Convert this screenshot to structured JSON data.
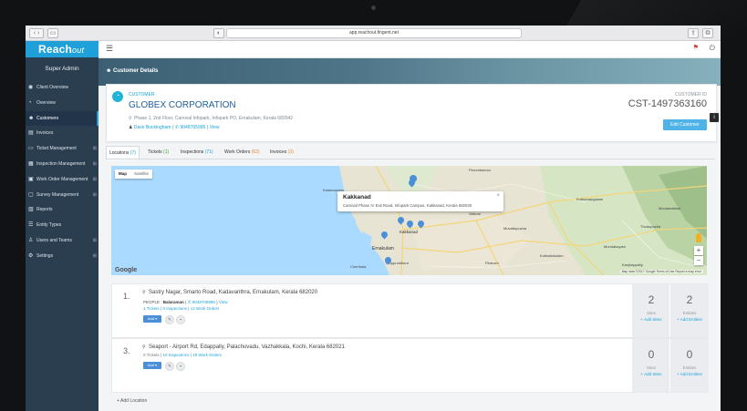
{
  "browser": {
    "url": "app.reachout.fingent.net"
  },
  "brand": {
    "name_a": "Reach",
    "name_b": "out"
  },
  "sidebar": {
    "role": "Super Admin",
    "items": [
      {
        "label": "Client Overview",
        "icon": "dashboard-icon",
        "caret": ""
      },
      {
        "label": "Overview",
        "icon": "pie-chart-icon",
        "caret": ""
      },
      {
        "label": "Customers",
        "icon": "users-icon",
        "caret": ""
      },
      {
        "label": "Invoices",
        "icon": "money-icon",
        "caret": ""
      },
      {
        "label": "Ticket Management",
        "icon": "monitor-icon",
        "caret": "⊞"
      },
      {
        "label": "Inspection Management",
        "icon": "clipboard-icon",
        "caret": "⊞"
      },
      {
        "label": "Work Order Management",
        "icon": "calendar-icon",
        "caret": "⊞"
      },
      {
        "label": "Survey Management",
        "icon": "comment-icon",
        "caret": "⊞"
      },
      {
        "label": "Reports",
        "icon": "bar-chart-icon",
        "caret": ""
      },
      {
        "label": "Entity Types",
        "icon": "list-icon",
        "caret": ""
      },
      {
        "label": "Users and Teams",
        "icon": "user-icon",
        "caret": "⊞"
      },
      {
        "label": "Settings",
        "icon": "gear-icon",
        "caret": "⊞"
      }
    ]
  },
  "header": {
    "title": "Customer Details"
  },
  "customer": {
    "label": "CUSTOMER",
    "name": "GLOBEX CORPORATION",
    "address": "Phase 1, 2nd Floor, Carnival Infopark, Infopark PO, Ernakulam, Kerala 682042",
    "contact_name": "Dave Buckingham",
    "contact_phone": "9048705995",
    "contact_view": "View",
    "id_label": "CUSTOMER ID",
    "id": "CST-1497363160",
    "edit_label": "Edit Customer"
  },
  "tabs": [
    {
      "label": "Locations",
      "count": "(7)"
    },
    {
      "label": "Tickets",
      "count": "(1)"
    },
    {
      "label": "Inspections",
      "count": "(71)"
    },
    {
      "label": "Work Orders",
      "count": "(62)"
    },
    {
      "label": "Invoices",
      "count": "(3)"
    }
  ],
  "map": {
    "toggle_map": "Map",
    "toggle_satellite": "Satellite",
    "info_title": "Kakkanad",
    "info_address": "Carnival Phase IV Exit Road, Infopark Campus, Kakkanad, Kerala 682030",
    "google": "Google",
    "footer": "Map data ©2017 Google   Terms of Use   Report a map error",
    "places": [
      {
        "name": "Perumbavoor"
      },
      {
        "name": "Kalamassery"
      },
      {
        "name": "Ernakulam"
      },
      {
        "name": "Kakkanad"
      },
      {
        "name": "Kothamangalam"
      },
      {
        "name": "Thodupuzha"
      },
      {
        "name": "Muvattupuzha"
      },
      {
        "name": "Thrippunithura"
      },
      {
        "name": "Moolamattom"
      },
      {
        "name": "Piravom"
      },
      {
        "name": "Kuthattukulam"
      },
      {
        "name": "Mundakayam"
      },
      {
        "name": "Kanjirappally"
      },
      {
        "name": "Vaikom"
      },
      {
        "name": "Cherthala"
      }
    ]
  },
  "locations": [
    {
      "num": "1.",
      "address": "Sastry Nagar, Smarto Road, Kadavanthra, Ernakulam, Kerala 682020",
      "people_label": "PEOPLE :",
      "person": "Balaraman",
      "phone": "9048705995",
      "view": "View",
      "tickets": "1 Tickets",
      "inspections": "0 Inspections",
      "work_orders": "12 Work Orders",
      "add": "Add ▾",
      "sites": "2",
      "sites_label": "Sites",
      "add_sites": "+ Add Sites",
      "entities": "2",
      "entities_label": "Entities",
      "add_entities": "+ Add Entities"
    },
    {
      "num": "3.",
      "address": "Seaport - Airport Rd, Edappally, Palachuvadu, Vazhakkala, Kochi, Kerala 682021",
      "tickets": "0 Tickets",
      "inspections": "10 Inspections",
      "work_orders": "10 Work Orders",
      "add": "Add ▾",
      "sites": "0",
      "sites_label": "Sites",
      "add_sites": "+ Add Sites",
      "entities": "0",
      "entities_label": "Entities",
      "add_entities": "+ Add Entities"
    }
  ],
  "add_location": "+ Add Location",
  "colors": {
    "accent": "#1fa0d8",
    "sidebar": "#2b3e50",
    "button": "#4fb3e8"
  }
}
